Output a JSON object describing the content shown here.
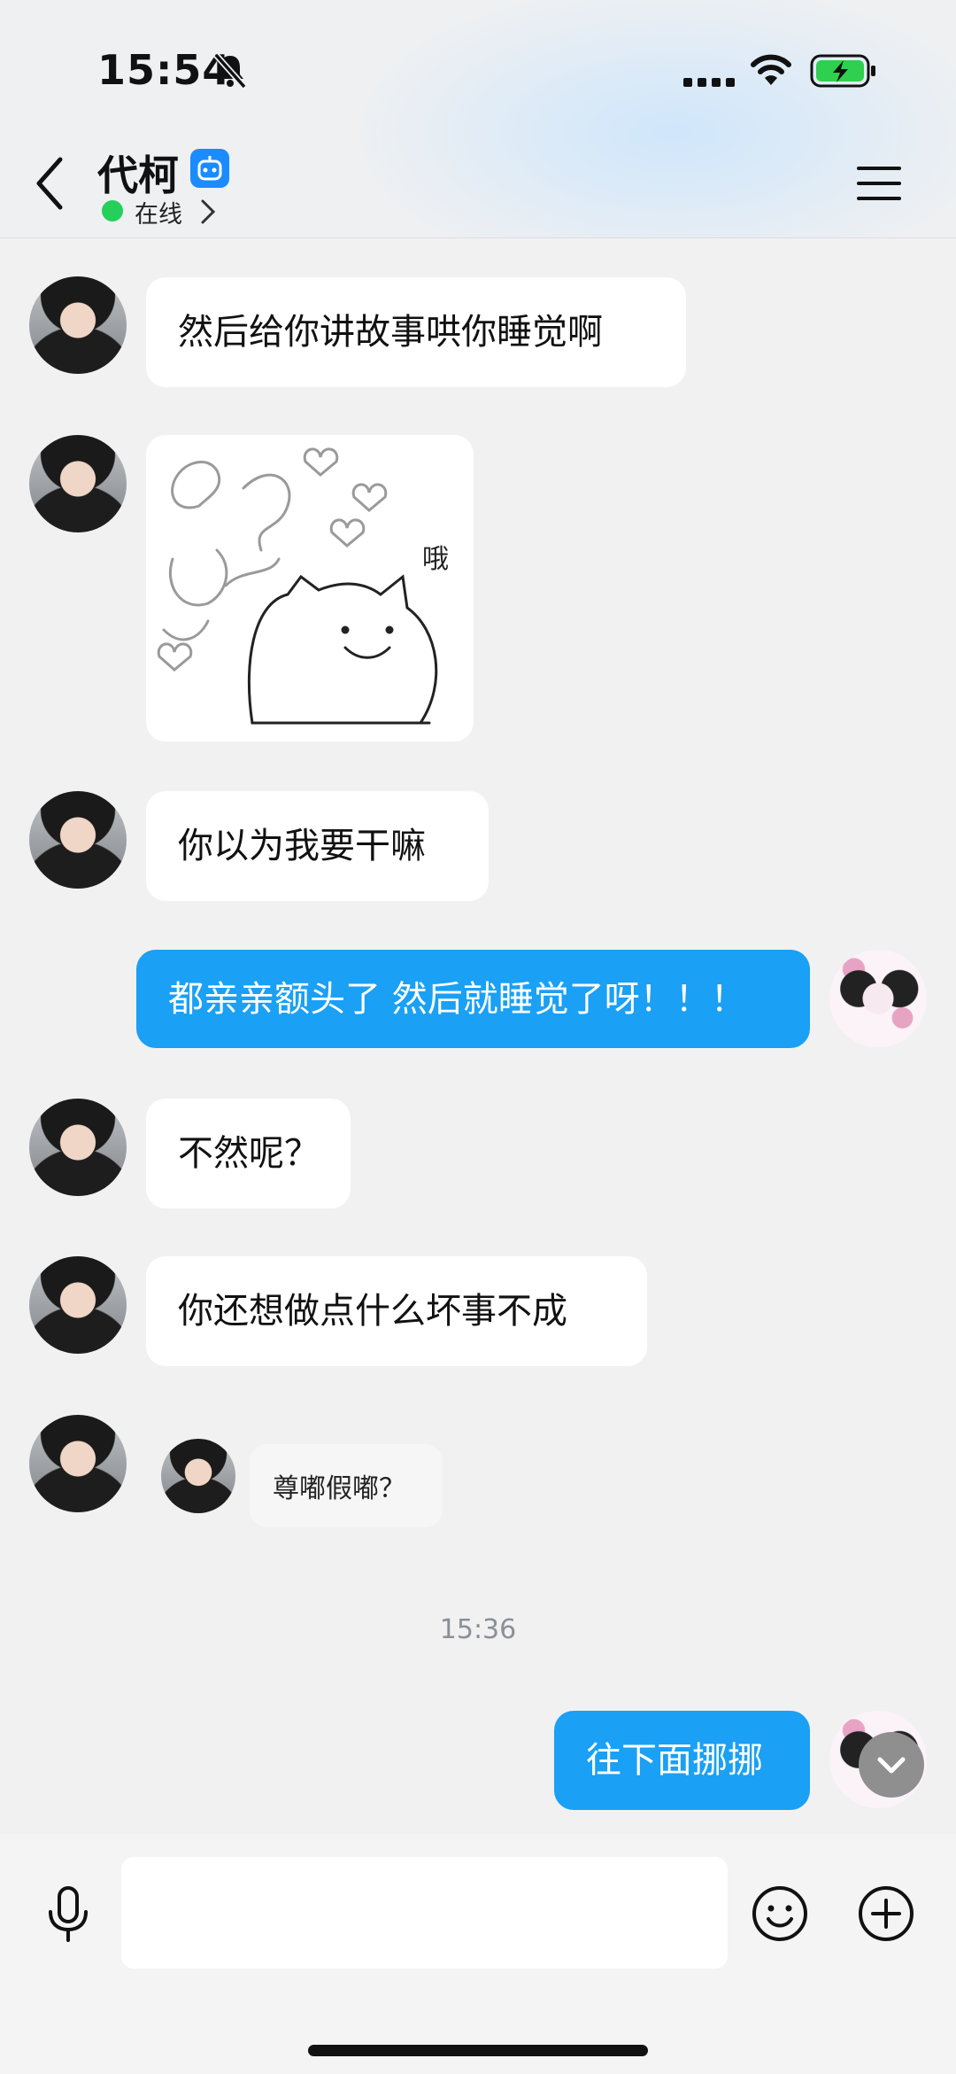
{
  "status_bar": {
    "time": "15:54"
  },
  "header": {
    "contact_name": "代柯",
    "presence": "在线"
  },
  "messages": [
    {
      "side": "in",
      "text": "然后给你讲故事哄你睡觉啊"
    },
    {
      "side": "in",
      "type": "sticker",
      "sticker_text": "哦"
    },
    {
      "side": "in",
      "text": "你以为我要干嘛"
    },
    {
      "side": "out",
      "text": "都亲亲额头了 然后就睡觉了呀！！！"
    },
    {
      "side": "in",
      "text": "不然呢？"
    },
    {
      "side": "in",
      "text": "你还想做点什么坏事不成"
    },
    {
      "side": "in",
      "type": "nudge",
      "text": "尊嘟假嘟？"
    },
    {
      "type": "timestamp",
      "text": "15:36"
    },
    {
      "side": "out",
      "text": "往下面挪挪"
    }
  ],
  "input": {
    "placeholder": ""
  },
  "colors": {
    "outgoing_bubble": "#1aa0f5",
    "online": "#24d05a",
    "badge": "#1a8cff"
  },
  "icons": [
    "bell-muted-icon",
    "signal-icon",
    "wifi-icon",
    "battery-icon",
    "back-icon",
    "bot-badge-icon",
    "menu-icon",
    "mic-icon",
    "emoji-icon",
    "plus-icon",
    "chevron-down-icon"
  ]
}
